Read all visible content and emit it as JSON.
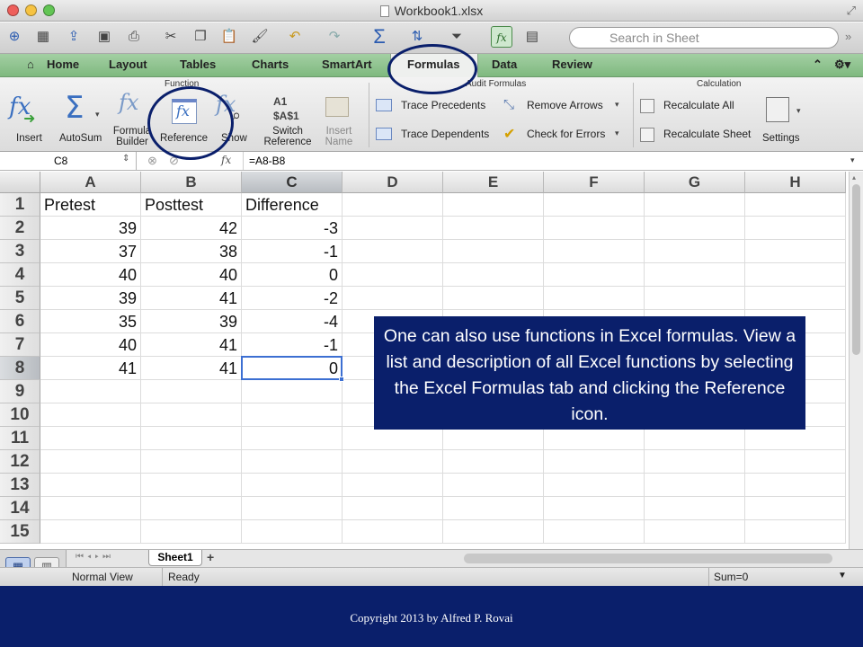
{
  "window": {
    "title": "Workbook1.xlsx"
  },
  "search": {
    "placeholder": "Search in Sheet"
  },
  "tabs": [
    "Home",
    "Layout",
    "Tables",
    "Charts",
    "SmartArt",
    "Formulas",
    "Data",
    "Review"
  ],
  "active_tab": "Formulas",
  "ribbon": {
    "groups": {
      "function": "Function",
      "audit": "Audit Formulas",
      "calc": "Calculation"
    },
    "function_buttons": [
      "Insert",
      "AutoSum",
      "Formula Builder",
      "Reference",
      "Show",
      "Switch Reference",
      "Insert Name"
    ],
    "switch_ref_icon_top": "A1",
    "switch_ref_icon_bottom": "$A$1",
    "fx_glyph": "fx",
    "sigma_glyph": "Σ",
    "audit_buttons": [
      "Trace Precedents",
      "Remove Arrows",
      "Trace Dependents",
      "Check for Errors"
    ],
    "calc_buttons": [
      "Recalculate All",
      "Recalculate Sheet",
      "Settings"
    ]
  },
  "formula_bar": {
    "cell_ref": "C8",
    "fx_label": "fx",
    "formula": "=A8-B8"
  },
  "columns": [
    "A",
    "B",
    "C",
    "D",
    "E",
    "F",
    "G",
    "H"
  ],
  "rows": [
    "1",
    "2",
    "3",
    "4",
    "5",
    "6",
    "7",
    "8",
    "9",
    "10",
    "11",
    "12",
    "13",
    "14",
    "15"
  ],
  "sheet": {
    "headers": [
      "Pretest",
      "Posttest",
      "Difference"
    ],
    "data": [
      [
        "39",
        "42",
        "-3"
      ],
      [
        "37",
        "38",
        "-1"
      ],
      [
        "40",
        "40",
        "0"
      ],
      [
        "39",
        "41",
        "-2"
      ],
      [
        "35",
        "39",
        "-4"
      ],
      [
        "40",
        "41",
        "-1"
      ],
      [
        "41",
        "41",
        "0"
      ]
    ]
  },
  "sheet_tab": {
    "name": "Sheet1",
    "add": "+"
  },
  "status": {
    "view": "Normal View",
    "ready": "Ready",
    "sum": "Sum=0"
  },
  "callout": {
    "text": "One can also use functions in Excel formulas. View a list and description of all Excel functions by selecting the Excel Formulas tab and clicking the Reference icon."
  },
  "footer": {
    "copyright": "Copyright 2013 by Alfred P. Rovai"
  },
  "colors": {
    "callout_bg": "#0a1f6b",
    "tab_bar": "#8fc48f",
    "selection": "#3c6fd2",
    "ribbon_icon": "#3a6fc0"
  }
}
